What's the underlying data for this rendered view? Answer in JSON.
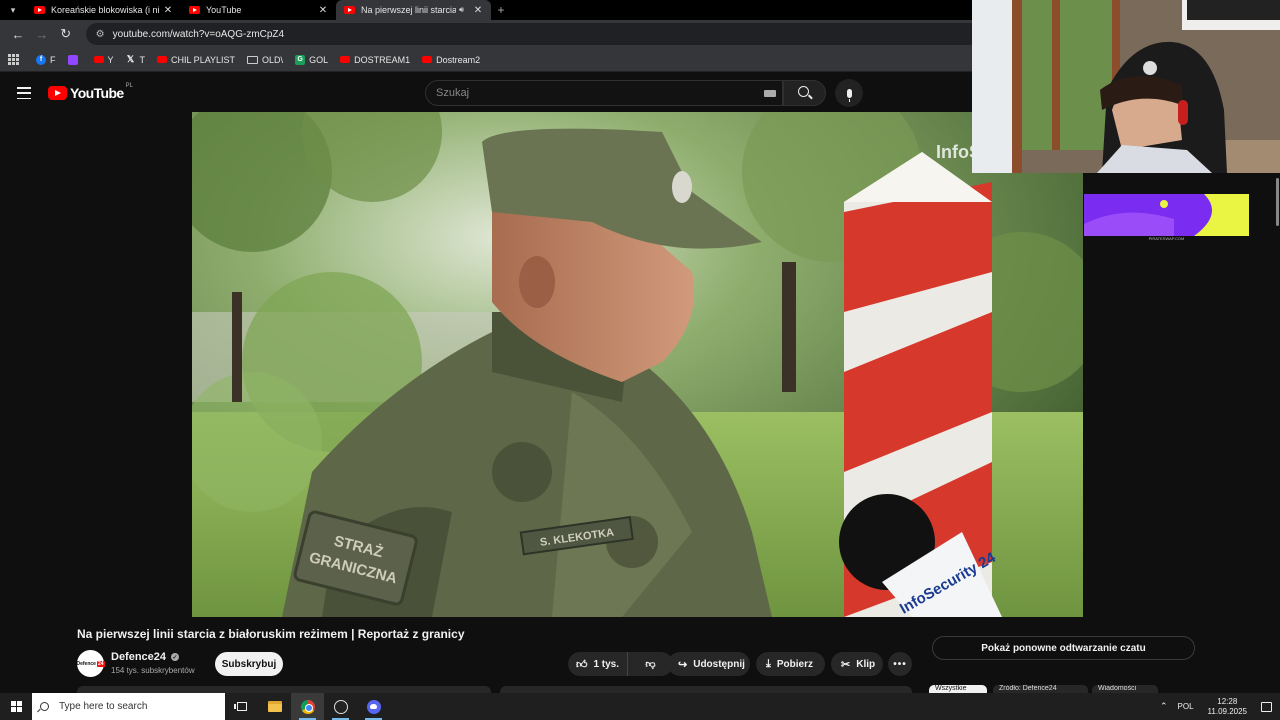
{
  "browser": {
    "tabs": [
      {
        "title": "Koreańskie blokowiska (i nie tylko)",
        "active": false,
        "audio": false
      },
      {
        "title": "YouTube",
        "active": false,
        "audio": false
      },
      {
        "title": "Na pierwszej linii starcia z białoruskim",
        "active": true,
        "audio": true
      }
    ],
    "url": "youtube.com/watch?v=oAQG-zmCpZ4",
    "bookmarks": [
      {
        "label": "F",
        "icon": "facebook-icon"
      },
      {
        "label": "",
        "icon": "twitch-icon"
      },
      {
        "label": "Y",
        "icon": "youtube-icon"
      },
      {
        "label": "T",
        "icon": "x-icon"
      },
      {
        "label": "CHIL PLAYLIST",
        "icon": "youtube-icon"
      },
      {
        "label": "OLD\\",
        "icon": "folder-icon"
      },
      {
        "label": "GOL",
        "icon": "gol-icon"
      },
      {
        "label": "DOSTREAM1",
        "icon": "youtube-icon"
      },
      {
        "label": "Dostream2",
        "icon": "youtube-icon"
      }
    ]
  },
  "youtube": {
    "logo_text": "YouTube",
    "country_code": "PL",
    "search_placeholder": "Szukaj",
    "video": {
      "watermark": "InfoS",
      "patch_text": "STRAŻ GRANICZNA",
      "name_tape": "S. KLEKOTKA",
      "mic_text": "InfoSecurity 24"
    },
    "title": "Na pierwszej linii starcia z białoruskim reżimem | Reportaż z granicy",
    "channel": {
      "name": "Defence24",
      "avatar_text": "Defence",
      "avatar_badge": "24",
      "subscribers": "154 tys. subskrybentów",
      "subscribe_label": "Subskrybuj"
    },
    "actions": {
      "likes": "1 tys.",
      "share": "Udostępnij",
      "download": "Pobierz",
      "clip": "Klip",
      "more": "•••"
    },
    "chat_replay": "Pokaż ponowne odtwarzanie czatu",
    "chips": [
      "Wszystkie",
      "Źródło: Defence24",
      "Wiadomości"
    ],
    "ad": {
      "caption": "PIRATESWAP.COM"
    }
  },
  "taskbar": {
    "search_placeholder": "Type here to search",
    "lang": "POL",
    "time": "12:28",
    "date": "11.09.2025"
  },
  "colors": {
    "yt_red": "#ff0000",
    "bg": "#0f0f0f",
    "pill": "#272727",
    "ad_purple": "#7a2cf0",
    "ad_yellow": "#e9f542"
  }
}
